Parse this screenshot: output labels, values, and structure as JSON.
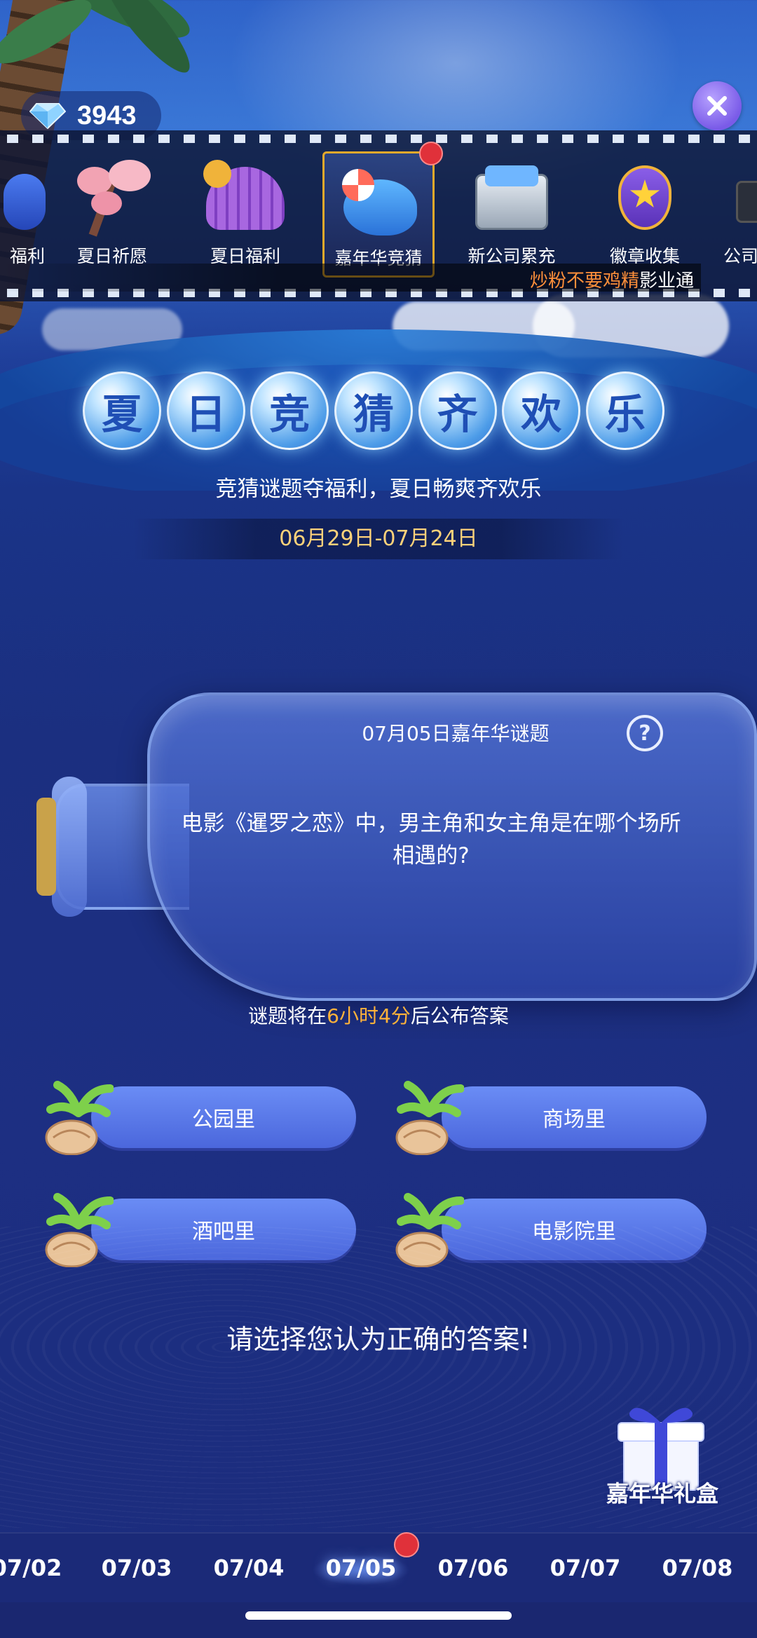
{
  "currency": {
    "amount": "3943",
    "icon": "diamond-icon"
  },
  "tabs": [
    {
      "label": "福利",
      "icon": "blue-character-icon",
      "active": false
    },
    {
      "label": "夏日祈愿",
      "icon": "cherry-blossom-icon",
      "active": false
    },
    {
      "label": "夏日福利",
      "icon": "shell-icon",
      "active": false
    },
    {
      "label": "嘉年华竞猜",
      "icon": "whale-icon",
      "active": true,
      "badge": true
    },
    {
      "label": "新公司累充",
      "icon": "treasure-chest-icon",
      "active": false
    },
    {
      "label": "徽章收集",
      "icon": "star-badge-icon",
      "active": false
    },
    {
      "label": "公司",
      "icon": "camera-icon",
      "active": false
    }
  ],
  "marquee": {
    "user": "炒粉不要鸡精",
    "text": "影业通"
  },
  "title_chars": [
    "夏",
    "日",
    "竞",
    "猜",
    "齐",
    "欢",
    "乐"
  ],
  "subtitle": "竞猜谜题夺福利，夏日畅爽齐欢乐",
  "date_range": "06月29日-07月24日",
  "puzzle": {
    "date_title": "07月05日嘉年华谜题",
    "question": "电影《暹罗之恋》中，男主角和女主角是在哪个场所相遇的?",
    "countdown_prefix": "谜题将在",
    "countdown_time": "6小时4分",
    "countdown_suffix": "后公布答案"
  },
  "options": [
    "公园里",
    "商场里",
    "酒吧里",
    "电影院里"
  ],
  "prompt": "请选择您认为正确的答案!",
  "gift_label": "嘉年华礼盒",
  "dates": [
    "07/02",
    "07/03",
    "07/04",
    "07/05",
    "07/06",
    "07/07",
    "07/08"
  ],
  "selected_date": "07/05",
  "colors": {
    "accent": "#ffb23a",
    "date_band": "#ffd27a",
    "badge": "#e0313a",
    "option": "#5b79e8"
  }
}
